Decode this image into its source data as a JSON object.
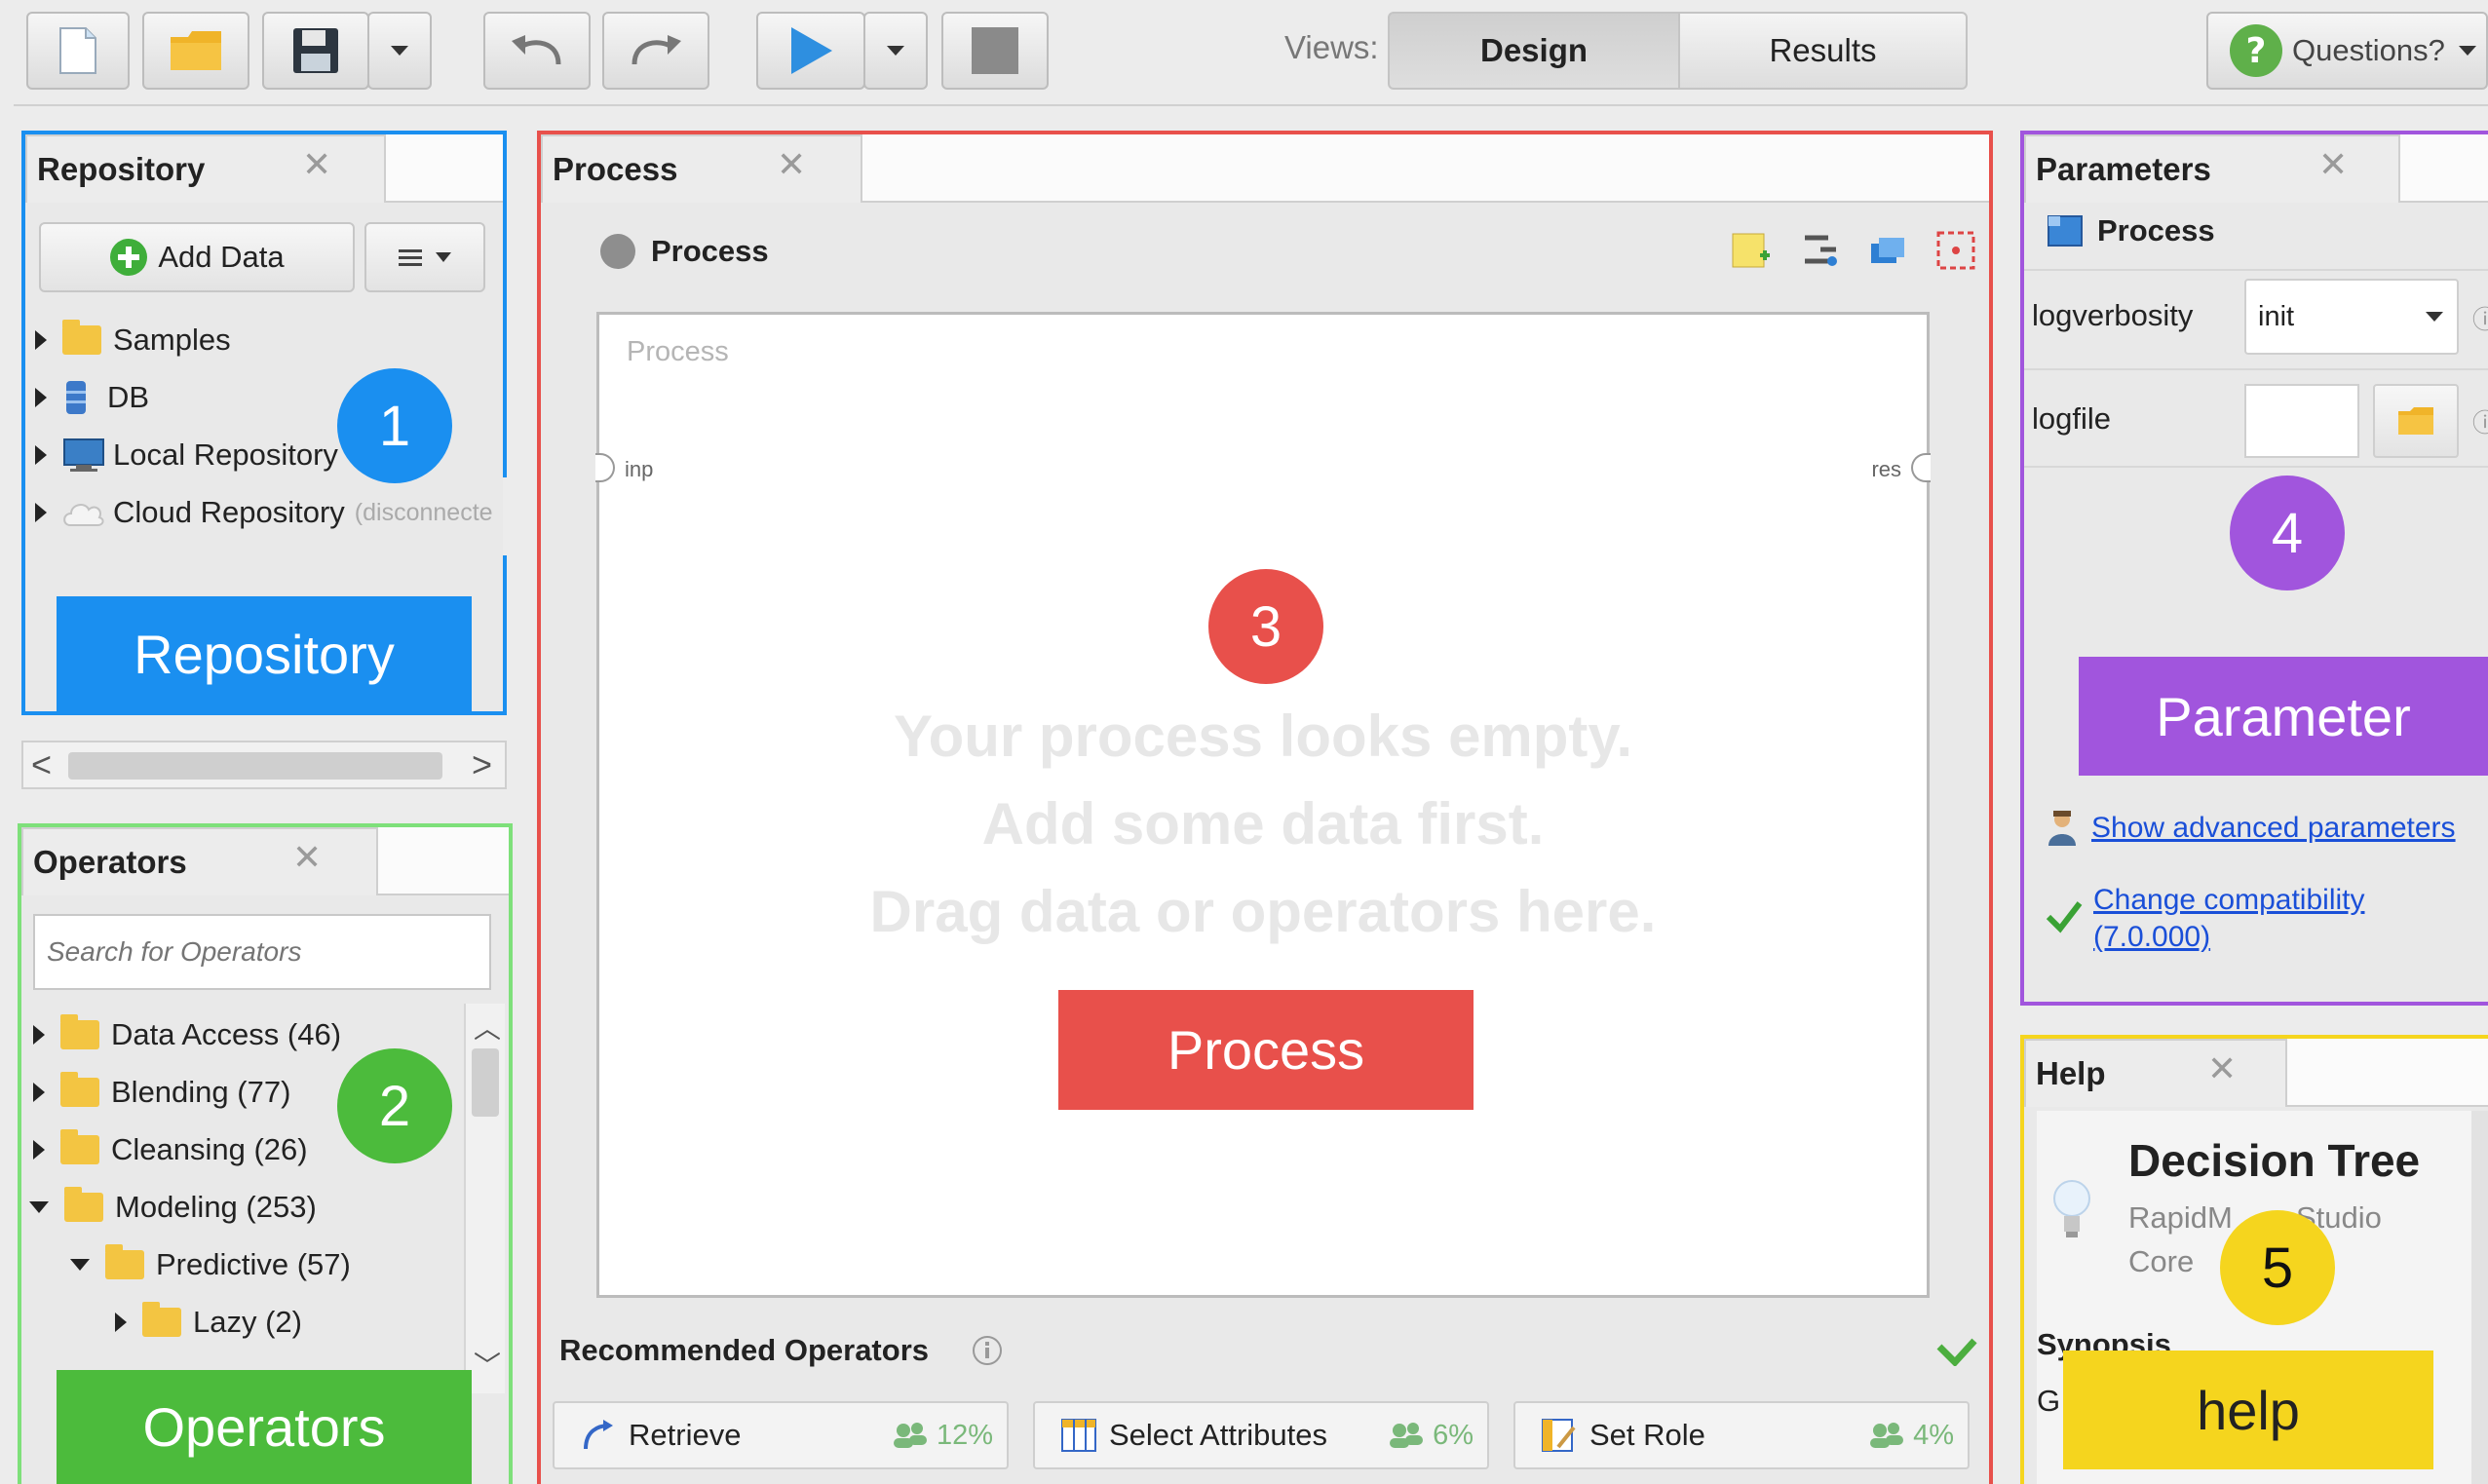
{
  "toolbar": {
    "views_label": "Views:",
    "view_tabs": [
      "Design",
      "Results"
    ],
    "questions_label": "Questions?"
  },
  "repository": {
    "title": "Repository",
    "add_data_label": "Add Data",
    "items": [
      {
        "label": "Samples",
        "icon": "folder-icon"
      },
      {
        "label": "DB",
        "icon": "database-icon"
      },
      {
        "label": "Local Repository",
        "icon": "computer-icon"
      },
      {
        "label": "Cloud Repository",
        "suffix": "(disconnecte",
        "icon": "cloud-icon"
      }
    ],
    "badge": "1",
    "overlay_label": "Repository"
  },
  "operators": {
    "title": "Operators",
    "search_placeholder": "Search for Operators",
    "items": [
      {
        "label": "Data Access (46)",
        "expanded": false
      },
      {
        "label": "Blending (77)",
        "expanded": false
      },
      {
        "label": "Cleansing (26)",
        "expanded": false
      },
      {
        "label": "Modeling (253)",
        "expanded": true
      },
      {
        "label": "Predictive (57)",
        "expanded": true
      },
      {
        "label": "Lazy (2)",
        "expanded": false
      }
    ],
    "badge": "2",
    "overlay_label": "Operators"
  },
  "process": {
    "title": "Process",
    "breadcrumb": "Process",
    "canvas_title": "Process",
    "port_in": "inp",
    "port_out": "res",
    "empty_lines": [
      "Your process looks empty.",
      "Add some data first.",
      "Drag data or operators here."
    ],
    "badge": "3",
    "overlay_label": "Process",
    "recommended_title": "Recommended Operators",
    "recommended": [
      {
        "label": "Retrieve",
        "pct": "12%"
      },
      {
        "label": "Select Attributes",
        "pct": "6%"
      },
      {
        "label": "Set Role",
        "pct": "4%"
      }
    ]
  },
  "parameters": {
    "title": "Parameters",
    "operator": "Process",
    "fields": [
      {
        "label": "logverbosity",
        "value": "init"
      },
      {
        "label": "logfile",
        "value": ""
      }
    ],
    "badge": "4",
    "overlay_label": "Parameter",
    "advanced_link": "Show advanced parameters",
    "compat_link_1": "Change compatibility",
    "compat_link_2": "(7.0.000)"
  },
  "help": {
    "title": "Help",
    "heading": "Decision Tree",
    "sub1": "RapidM",
    "sub1b": "Studio",
    "sub2": "Core",
    "synopsis": "Synopsis",
    "line": "G",
    "badge": "5",
    "overlay_label": "help"
  },
  "colors": {
    "repository": "#1a8ff0",
    "operators": "#4cbb3c",
    "process": "#e8504b",
    "parameters": "#a155dd",
    "help": "#f5d51e"
  }
}
